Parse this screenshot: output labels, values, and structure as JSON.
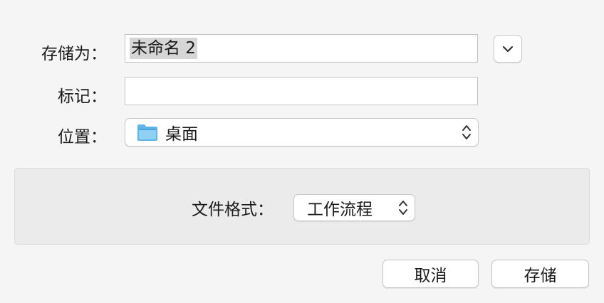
{
  "save_as": {
    "label": "存储为：",
    "value": "未命名 2"
  },
  "tags": {
    "label": "标记：",
    "value": ""
  },
  "location": {
    "label": "位置：",
    "value": "桌面",
    "icon": "folder-icon"
  },
  "expand_icon": "chevron-down-icon",
  "file_format": {
    "label": "文件格式：",
    "value": "工作流程"
  },
  "buttons": {
    "cancel": "取消",
    "save": "存储"
  },
  "colors": {
    "folder": "#5fb4e8",
    "panel": "#ebebeb"
  }
}
